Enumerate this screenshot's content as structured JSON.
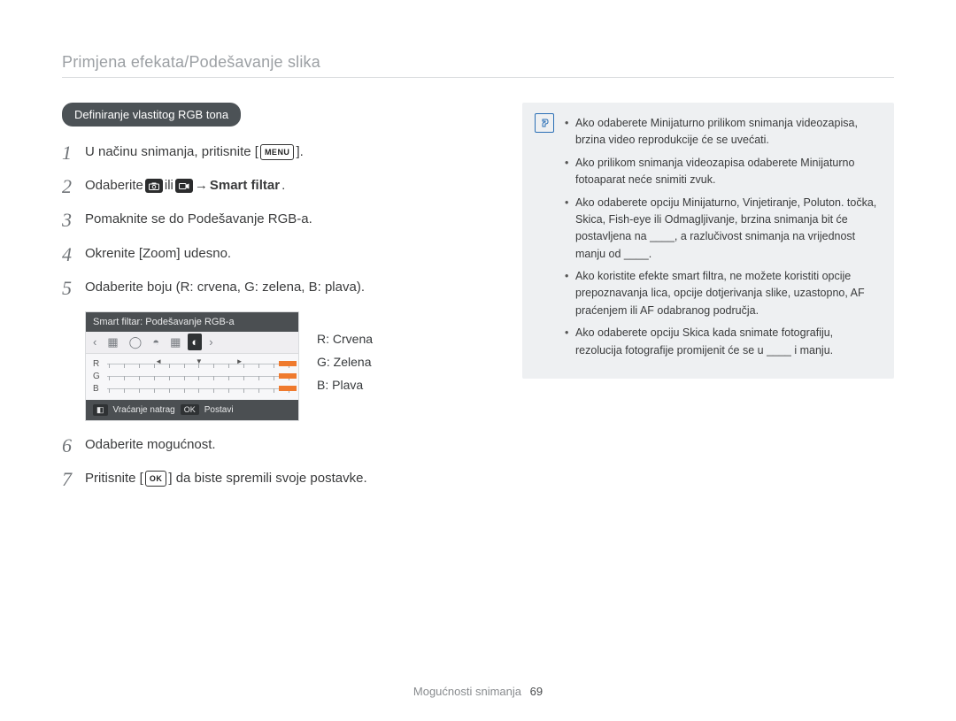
{
  "header": {
    "title": "Primjena efekata/Podešavanje slika"
  },
  "section": {
    "chip": "Deﬁniranje vlastitog RGB tona"
  },
  "steps": {
    "s1_pre": "U načinu snimanja, pritisnite [",
    "menu_badge": "MENU",
    "s1_post": "].",
    "s2_pre": "Odaberite ",
    "or_word": " ili ",
    "arrow": " → ",
    "smart_filter": "Smart ﬁltar",
    "s2_end": ".",
    "s3": "Pomaknite se do Podešavanje RGB-a.",
    "s4": "Okrenite [Zoom] udesno.",
    "s5": "Odaberite boju (R: crvena, G: zelena, B: plava).",
    "s6": "Odaberite mogućnost.",
    "s7_pre": "Pritisnite [",
    "ok_badge": "OK",
    "s7_post": "] da biste spremili svoje postavke."
  },
  "step_nums": {
    "n1": "1",
    "n2": "2",
    "n3": "3",
    "n4": "4",
    "n5": "5",
    "n6": "6",
    "n7": "7"
  },
  "figure": {
    "screen_title": "Smart ﬁltar: Podešavanje RGB-a",
    "row_r": "R",
    "row_g": "G",
    "row_b": "B",
    "footer_back": "Vraćanje natrag",
    "footer_set": "Postavi"
  },
  "callouts": {
    "r": "R: Crvena",
    "g": "G: Zelena",
    "b": "B: Plava"
  },
  "info": {
    "items": [
      "Ako odaberete Minijaturno prilikom snimanja videozapisa, brzina video reprodukcije će se uvećati.",
      "Ako prilikom snimanja videozapisa odaberete Minijaturno fotoaparat neće snimiti zvuk.",
      "Ako odaberete opciju Minijaturno, Vinjetiranje, Poluton. točka, Skica, Fish-eye ili Odmagljivanje, brzina snimanja bit će postavljena na ____, a razlučivost snimanja na vrijednost manju od ____.",
      "Ako koristite efekte smart ﬁltra, ne možete koristiti opcije prepoznavanja lica, opcije dotjerivanja slike, uzastopno, AF praćenjem ili AF odabranog područja.",
      "Ako odaberete opciju Skica kada snimate fotograﬁju, rezolucija fotograﬁje promijenit će se u ____ i manju."
    ]
  },
  "footer": {
    "label": "Mogućnosti snimanja",
    "page": "69"
  }
}
